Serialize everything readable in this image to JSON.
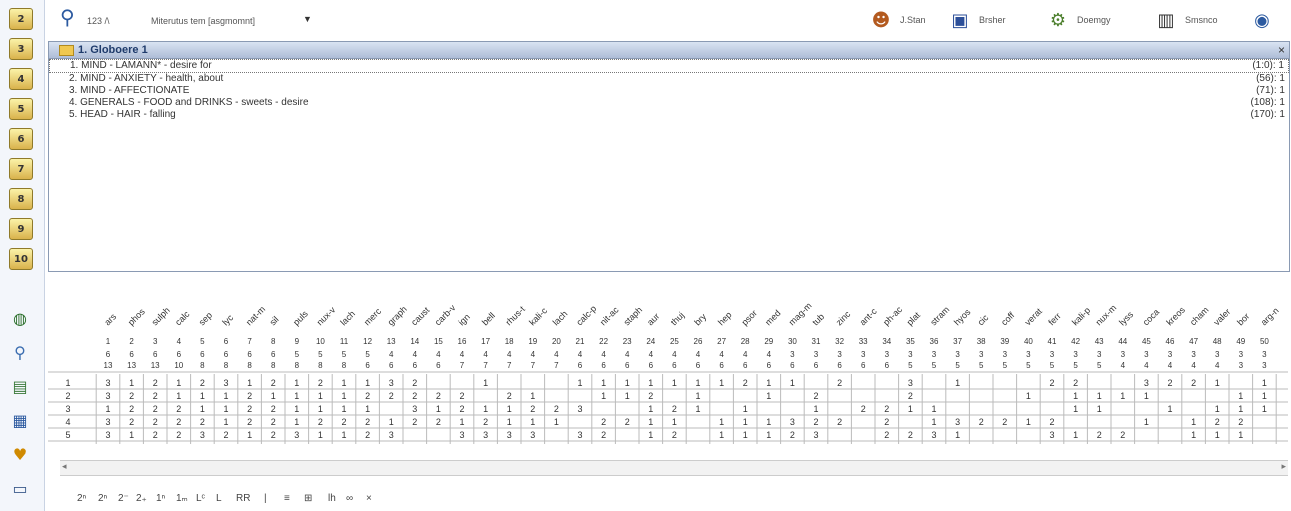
{
  "left_toolbar": {
    "buttons": [
      {
        "label": "2",
        "icon": "number-2-icon"
      },
      {
        "label": "3",
        "icon": "number-3-icon"
      },
      {
        "label": "4",
        "icon": "number-4-icon"
      },
      {
        "label": "5",
        "icon": "number-5-icon"
      },
      {
        "label": "6",
        "icon": "number-6-icon"
      },
      {
        "label": "7",
        "icon": "number-7-icon"
      },
      {
        "label": "8",
        "icon": "number-8-icon"
      },
      {
        "label": "9",
        "icon": "number-9-icon"
      },
      {
        "label": "10",
        "icon": "number-10-icon"
      }
    ],
    "extra_icons": [
      "globe-icon",
      "magnet-icon",
      "repertory-icon",
      "chart-icon",
      "heart-icon",
      "window-icon"
    ]
  },
  "top_bar": {
    "search_icon": "search-icon",
    "count": "123 /\\",
    "method": "Miterutus tem [asgmomnt]",
    "dropdown": "▼",
    "tools": [
      {
        "label": "J.Stan",
        "icon": "person-icon"
      },
      {
        "label": "Brsher",
        "icon": "book-icon"
      },
      {
        "label": "Doemgy",
        "icon": "gear-icon"
      },
      {
        "label": "Smsnco",
        "icon": "building-icon"
      }
    ],
    "help_icon": "globe-help-icon"
  },
  "rubrics_panel": {
    "title": "1. Globoere 1",
    "close": "×",
    "rubrics": [
      {
        "text": "1. MIND - LAMANN* - desire for",
        "count": "(1:0): 1"
      },
      {
        "text": "2. MIND - ANXIETY - health, about",
        "count": "(56): 1"
      },
      {
        "text": "3. MIND - AFFECTIONATE",
        "count": "(71): 1"
      },
      {
        "text": "4. GENERALS - FOOD and DRINKS - sweets - desire",
        "count": "(108): 1"
      },
      {
        "text": "5. HEAD - HAIR - falling",
        "count": "(170): 1"
      }
    ]
  },
  "repertorization": {
    "remedies": [
      "ars",
      "phos",
      "sulph",
      "calc",
      "sep",
      "lyc",
      "nat-m",
      "sil",
      "puls",
      "nux-v",
      "lach",
      "merc",
      "graph",
      "caust",
      "carb-v",
      "ign",
      "bell",
      "rhus-t",
      "kali-c",
      "lach",
      "calc-p",
      "nit-ac",
      "staph",
      "aur",
      "thuj",
      "bry",
      "hep",
      "psor",
      "med",
      "mag-m",
      "tub",
      "zinc",
      "ant-c",
      "ph-ac",
      "plat",
      "stram",
      "hyos",
      "cic",
      "coff",
      "verat",
      "ferr",
      "kali-p",
      "nux-m",
      "lyss",
      "coca",
      "kreos",
      "cham",
      "valer",
      "bor",
      "arg-n"
    ],
    "scores": [
      "6",
      "6",
      "6",
      "6",
      "6",
      "6",
      "6",
      "6",
      "5",
      "5",
      "5",
      "5",
      "4",
      "4",
      "4",
      "4",
      "4",
      "4",
      "4",
      "4",
      "4",
      "4",
      "4",
      "4",
      "4",
      "4",
      "4",
      "4",
      "4",
      "3",
      "3",
      "3",
      "3",
      "3",
      "3",
      "3",
      "3",
      "3",
      "3",
      "3",
      "3",
      "3",
      "3",
      "3",
      "3",
      "3",
      "3",
      "3",
      "3",
      "3"
    ],
    "rubric_counts": [
      "13",
      "13",
      "13",
      "10",
      "8",
      "8",
      "8",
      "8",
      "8",
      "8",
      "8",
      "6",
      "6",
      "6",
      "6",
      "7",
      "7",
      "7",
      "7",
      "7",
      "6",
      "6",
      "6",
      "6",
      "6",
      "6",
      "6",
      "6",
      "6",
      "6",
      "6",
      "6",
      "6",
      "6",
      "5",
      "5",
      "5",
      "5",
      "5",
      "5",
      "5",
      "5",
      "5",
      "4",
      "4",
      "4",
      "4",
      "4",
      "3",
      "3"
    ],
    "rows": [
      {
        "n": "1",
        "cells": [
          "3",
          "1",
          "2",
          "1",
          "2",
          "3",
          "1",
          "2",
          "1",
          "2",
          "1",
          "1",
          "3",
          "2",
          "",
          "",
          "1",
          "",
          "",
          "",
          "1",
          "1",
          "1",
          "1",
          "1",
          "1",
          "1",
          "2",
          "1",
          "1",
          "",
          "2",
          "",
          "",
          "3",
          "",
          "1",
          "",
          "",
          "",
          "2",
          "2",
          "",
          "",
          "3",
          "2",
          "2",
          "1",
          "",
          "1"
        ]
      },
      {
        "n": "2",
        "cells": [
          "3",
          "2",
          "2",
          "1",
          "1",
          "1",
          "2",
          "1",
          "1",
          "1",
          "1",
          "2",
          "2",
          "2",
          "2",
          "2",
          "",
          "2",
          "1",
          "",
          "",
          "1",
          "1",
          "2",
          "",
          "1",
          "",
          "",
          "1",
          "",
          "2",
          "",
          "",
          "",
          "2",
          "",
          "",
          "",
          "",
          "1",
          "",
          "1",
          "1",
          "1",
          "1",
          "",
          "",
          "",
          "1",
          "1"
        ]
      },
      {
        "n": "3",
        "cells": [
          "1",
          "2",
          "2",
          "2",
          "1",
          "1",
          "2",
          "2",
          "1",
          "1",
          "1",
          "1",
          "",
          "3",
          "1",
          "2",
          "1",
          "1",
          "2",
          "2",
          "3",
          "",
          "",
          "1",
          "2",
          "1",
          "",
          "1",
          "",
          "",
          "1",
          "",
          "2",
          "2",
          "1",
          "1",
          "",
          "",
          "",
          "",
          "",
          "1",
          "1",
          "",
          "",
          "1",
          "",
          "1",
          "1",
          "1"
        ]
      },
      {
        "n": "4",
        "cells": [
          "3",
          "2",
          "2",
          "2",
          "2",
          "1",
          "2",
          "2",
          "1",
          "2",
          "2",
          "2",
          "1",
          "2",
          "2",
          "1",
          "2",
          "1",
          "1",
          "1",
          "",
          "2",
          "2",
          "1",
          "1",
          "",
          "1",
          "1",
          "1",
          "3",
          "2",
          "2",
          "",
          "2",
          "",
          "1",
          "3",
          "2",
          "2",
          "1",
          "2",
          "",
          "",
          "",
          "1",
          "",
          "1",
          "2",
          "2",
          ""
        ]
      },
      {
        "n": "5",
        "cells": [
          "3",
          "1",
          "2",
          "2",
          "3",
          "2",
          "1",
          "2",
          "3",
          "1",
          "1",
          "2",
          "3",
          "",
          "",
          "3",
          "3",
          "3",
          "3",
          "",
          "3",
          "2",
          "",
          "1",
          "2",
          "",
          "1",
          "1",
          "1",
          "2",
          "3",
          "",
          "",
          "2",
          "2",
          "3",
          "1",
          "",
          "",
          "",
          "3",
          "1",
          "2",
          "2",
          "",
          "",
          "1",
          "1",
          "1",
          ""
        ]
      }
    ]
  },
  "bottom_toolbar": {
    "buttons": [
      "2ⁿ",
      "2ⁿ",
      "2⁻",
      "2₊",
      "1ⁿ",
      "1ₘ",
      "Lᶜ",
      "L",
      "RR",
      "|",
      "≡",
      "⊞",
      "lh",
      "∞",
      "×"
    ]
  }
}
